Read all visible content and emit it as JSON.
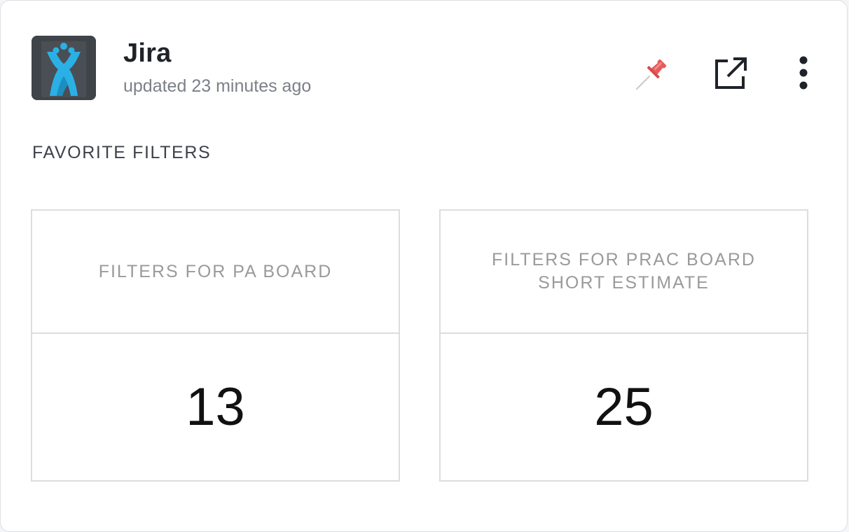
{
  "header": {
    "app_name": "Jira",
    "updated_text": "updated 23 minutes ago",
    "icons": {
      "app": "jira-logo-icon",
      "pin": "pin-icon",
      "external": "open-external-icon",
      "more": "more-vertical-icon"
    }
  },
  "section": {
    "heading": "FAVORITE FILTERS"
  },
  "filters": [
    {
      "label": "FILTERS FOR PA BOARD",
      "count": "13"
    },
    {
      "label": "FILTERS FOR PRAC BOARD SHORT ESTIMATE",
      "count": "25"
    }
  ],
  "colors": {
    "jira_blue": "#2bb0e6",
    "pin_red": "#e8595a",
    "icon_dark": "#1f2329"
  }
}
